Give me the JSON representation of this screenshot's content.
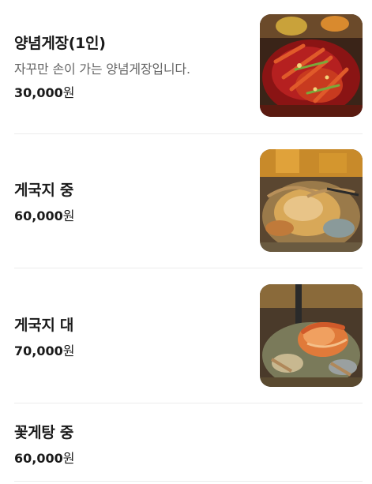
{
  "menu": {
    "items": [
      {
        "name": "양념게장(1인)",
        "description": "자꾸만 손이 가는 양념게장입니다.",
        "price": "30,000",
        "currency": "원",
        "image": "seasoned-crab-photo"
      },
      {
        "name": "게국지 중",
        "price": "60,000",
        "currency": "원",
        "image": "crab-stew-photo"
      },
      {
        "name": "게국지 대",
        "price": "70,000",
        "currency": "원",
        "image": "crab-shrimp-stew-photo"
      },
      {
        "name": "꽃게탕 중",
        "price": "60,000",
        "currency": "원"
      }
    ]
  }
}
